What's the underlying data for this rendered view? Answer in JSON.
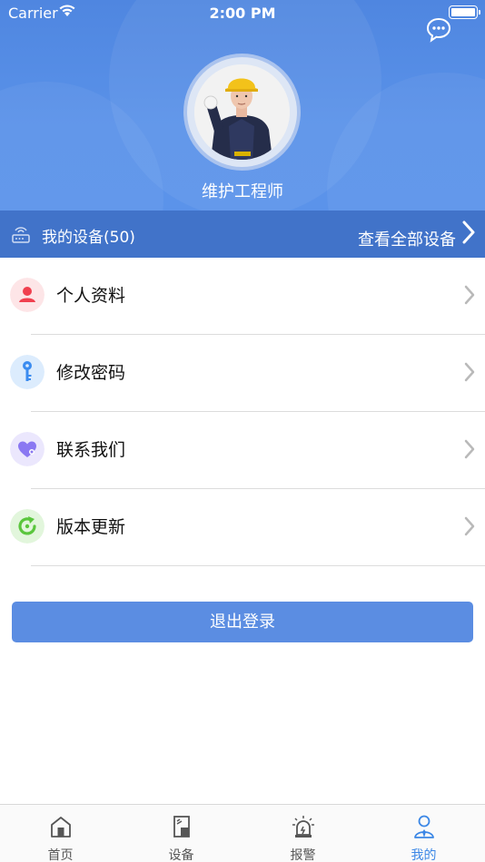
{
  "status_bar": {
    "carrier": "Carrier",
    "time": "2:00 PM"
  },
  "profile": {
    "role": "维护工程师"
  },
  "devices": {
    "title": "我的设备(50)",
    "view_all": "查看全部设备"
  },
  "menu": [
    {
      "label": "个人资料",
      "icon": "person-icon",
      "color": "#f0404f"
    },
    {
      "label": "修改密码",
      "icon": "key-icon",
      "color": "#3b8cf0"
    },
    {
      "label": "联系我们",
      "icon": "heart-chat-icon",
      "color": "#8a78f2"
    },
    {
      "label": "版本更新",
      "icon": "refresh-icon",
      "color": "#5ac63d"
    }
  ],
  "logout_label": "退出登录",
  "tabs": [
    {
      "label": "首页",
      "icon": "home-icon",
      "active": false
    },
    {
      "label": "设备",
      "icon": "device-icon",
      "active": false
    },
    {
      "label": "报警",
      "icon": "alarm-icon",
      "active": false
    },
    {
      "label": "我的",
      "icon": "user-icon",
      "active": true
    }
  ],
  "colors": {
    "header": "#5a92e9",
    "devices_bar": "#4173c9",
    "logout": "#5b8de2",
    "tab_active": "#3b87e6"
  }
}
